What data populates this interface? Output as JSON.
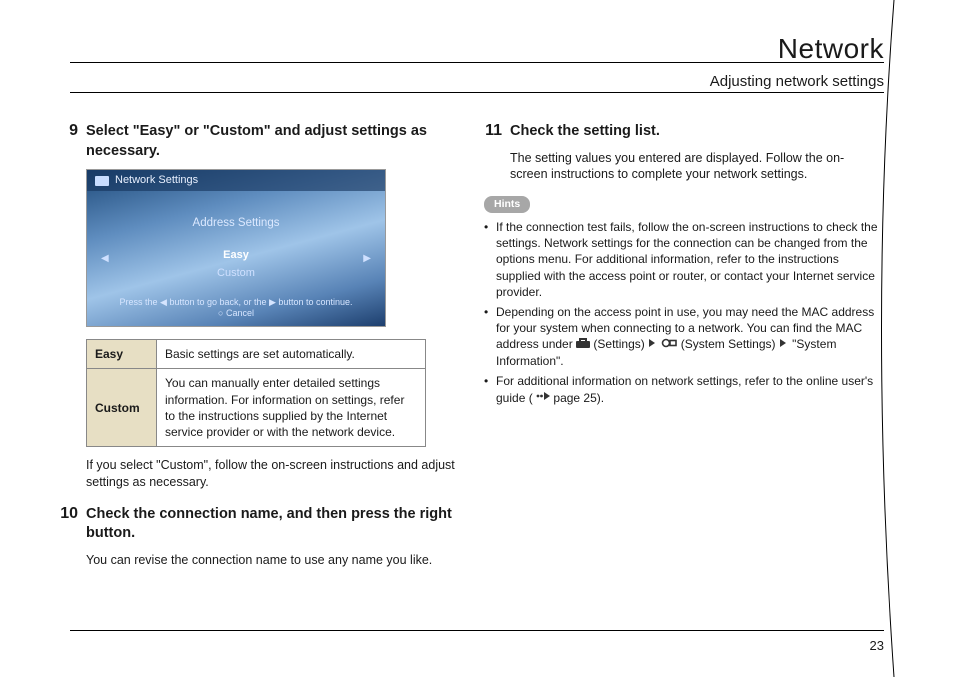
{
  "header": {
    "section_title": "Network",
    "sub_title": "Adjusting network settings"
  },
  "left_col": {
    "step9": {
      "num": "9",
      "title": "Select \"Easy\" or \"Custom\" and adjust settings as necessary."
    },
    "screenshot": {
      "titlebar": "Network Settings",
      "address_settings": "Address Settings",
      "easy": "Easy",
      "custom": "Custom",
      "footer_line1": "Press the ◀ button to go back, or the ▶ button to continue.",
      "footer_line2": "○ Cancel"
    },
    "table": {
      "easy_label": "Easy",
      "easy_desc": "Basic settings are set automatically.",
      "custom_label": "Custom",
      "custom_desc": "You can manually enter detailed settings information. For information on settings, refer to the instructions supplied by the Internet service provider or with the network device."
    },
    "note_custom": "If you select \"Custom\", follow the on-screen instructions and adjust settings as necessary.",
    "step10": {
      "num": "10",
      "title": "Check the connection name, and then press the right button.",
      "body": "You can revise the connection name to use any name you like."
    }
  },
  "right_col": {
    "step11": {
      "num": "11",
      "title": "Check the setting list.",
      "body": "The setting values you entered are displayed. Follow the on-screen instructions to complete your network settings."
    },
    "hints_label": "Hints",
    "hints": {
      "item1": "If the connection test fails, follow the on-screen instructions to check the settings. Network settings for the connection can be changed from the options menu. For additional information, refer to the instructions supplied with the access point or router, or contact your Internet service provider.",
      "item2_p1": "Depending on the access point in use, you may need the MAC address for your system when connecting to a network. You can find the MAC address under ",
      "item2_settings_label": " (Settings)",
      "item2_p2": " (System Settings) ",
      "item2_p3": " \"System Information\".",
      "item3_p1": "For additional information on network settings, refer to the online user's guide (",
      "item3_p2": " page 25)."
    }
  },
  "page_number": "23"
}
